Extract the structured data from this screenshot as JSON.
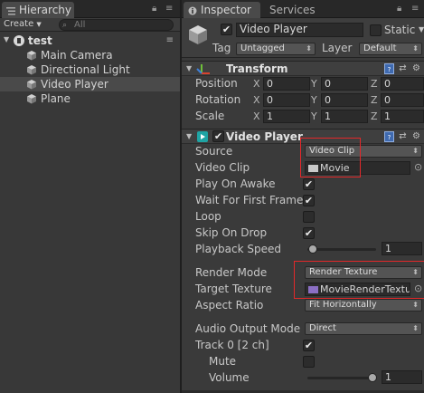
{
  "hierarchy": {
    "tab_label": "Hierarchy",
    "create_label": "Create",
    "search_placeholder": "All",
    "scene_name": "test",
    "items": [
      {
        "label": "Main Camera",
        "selected": false
      },
      {
        "label": "Directional Light",
        "selected": false
      },
      {
        "label": "Video Player",
        "selected": true
      },
      {
        "label": "Plane",
        "selected": false
      }
    ]
  },
  "inspector": {
    "tabs": {
      "inspector": "Inspector",
      "services": "Services"
    },
    "object": {
      "name": "Video Player",
      "active": true,
      "static_label": "Static",
      "static": false,
      "tag_label": "Tag",
      "tag_value": "Untagged",
      "layer_label": "Layer",
      "layer_value": "Default"
    },
    "transform": {
      "title": "Transform",
      "rows": [
        {
          "label": "Position",
          "x": "0",
          "y": "0",
          "z": "0"
        },
        {
          "label": "Rotation",
          "x": "0",
          "y": "0",
          "z": "0"
        },
        {
          "label": "Scale",
          "x": "1",
          "y": "1",
          "z": "1"
        }
      ],
      "axes": {
        "x": "X",
        "y": "Y",
        "z": "Z"
      }
    },
    "video_player": {
      "title": "Video Player",
      "enabled": true,
      "source_label": "Source",
      "source_value": "Video Clip",
      "clip_label": "Video Clip",
      "clip_value": "Movie",
      "play_on_awake_label": "Play On Awake",
      "play_on_awake": true,
      "wait_label": "Wait For First Frame",
      "wait": true,
      "loop_label": "Loop",
      "loop": false,
      "skip_label": "Skip On Drop",
      "skip": true,
      "speed_label": "Playback Speed",
      "speed_value": "1",
      "render_mode_label": "Render Mode",
      "render_mode_value": "Render Texture",
      "target_texture_label": "Target Texture",
      "target_texture_value": "MovieRenderTextu",
      "aspect_label": "Aspect Ratio",
      "aspect_value": "Fit Horizontally",
      "audio_mode_label": "Audio Output Mode",
      "audio_mode_value": "Direct",
      "track_label": "Track 0 [2 ch]",
      "track": true,
      "mute_label": "Mute",
      "mute": false,
      "volume_label": "Volume",
      "volume_value": "1"
    }
  },
  "colors": {
    "highlight_box": "#e3282a",
    "selection": "#4a4a4a"
  }
}
